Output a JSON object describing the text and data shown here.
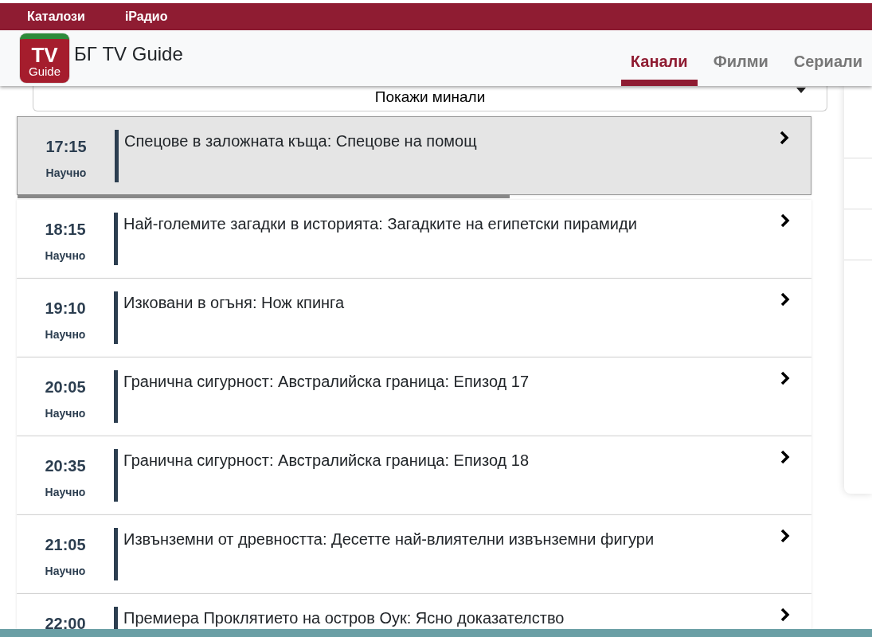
{
  "top_links": [
    {
      "label": "Каталози"
    },
    {
      "label": "iРадио"
    }
  ],
  "logo": {
    "line1": "TV",
    "line2": "Guide"
  },
  "brand": "БГ TV Guide",
  "tabs": [
    {
      "label": "Канали",
      "selected": true
    },
    {
      "label": "Филми",
      "selected": false
    },
    {
      "label": "Сериали",
      "selected": false
    }
  ],
  "past_toggle": {
    "label": "Покажи минали"
  },
  "programs": [
    {
      "time": "17:15",
      "category": "Научно",
      "title": "Спецове в заложната къща: Спецове на помощ",
      "selected": true,
      "level": 0.62
    },
    {
      "time": "18:15",
      "category": "Научно",
      "title": "Най-големите загадки в историята: Загадките на египетски пирамиди",
      "selected": false
    },
    {
      "time": "19:10",
      "category": "Научно",
      "title": "Изковани в огъня: Нож кпинга",
      "selected": false
    },
    {
      "time": "20:05",
      "category": "Научно",
      "title": "Гранична сигурност: Австралийска граница: Епизод 17",
      "selected": false
    },
    {
      "time": "20:35",
      "category": "Научно",
      "title": "Гранична сигурност: Австралийска граница: Епизод 18",
      "selected": false
    },
    {
      "time": "21:05",
      "category": "Научно",
      "title": "Извънземни от древността: Десетте най-влиятелни извънземни фигури",
      "selected": false
    },
    {
      "time": "22:00",
      "title": "Премиера Проклятието на остров Оук: Ясно доказателство",
      "selected": false
    }
  ]
}
